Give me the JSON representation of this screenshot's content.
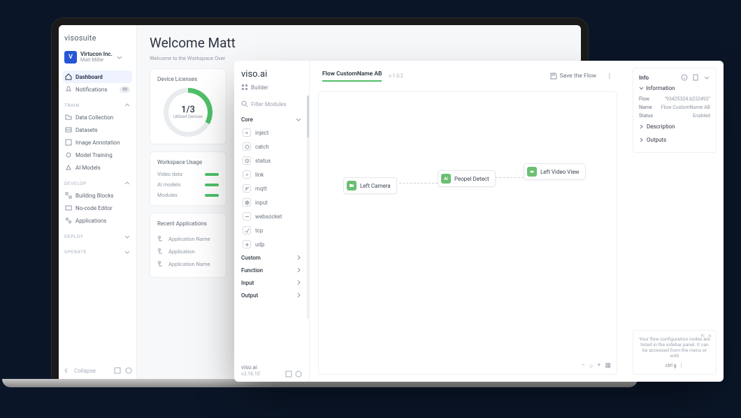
{
  "suite": {
    "brand": "visosuite",
    "org": {
      "logo_letter": "V",
      "name": "Virtucon Inc.",
      "user": "Matt Miller"
    },
    "nav_primary": [
      {
        "label": "Dashboard",
        "active": true
      },
      {
        "label": "Notifications",
        "badge": "99"
      }
    ],
    "groups": [
      {
        "title": "TRAIN",
        "items": [
          "Data Collection",
          "Datasets",
          "Image Annotation",
          "Model Training",
          "AI Models"
        ]
      },
      {
        "title": "DEVELOP",
        "items": [
          "Building Blocks",
          "No-code Editor",
          "Applications"
        ]
      },
      {
        "title": "DEPLOY",
        "items": []
      },
      {
        "title": "OPERATE",
        "items": []
      }
    ],
    "collapse_label": "Collapse",
    "main": {
      "welcome": "Welcome Matt",
      "subtext": "Welcome to the Workspace Over",
      "licenses_title": "Device Licenses",
      "gauge_value": "1/3",
      "gauge_label": "Utilized Devices",
      "usage_title": "Workspace Usage",
      "usage_rows": [
        "Video data",
        "AI models",
        "Modules"
      ],
      "recent_title": "Recent Applications",
      "recent_rows": [
        "Application Name",
        "Application",
        "Application Name"
      ]
    }
  },
  "builder": {
    "brand": "viso.ai",
    "builder_label": "Builder",
    "filter_placeholder": "Filter Modules",
    "categories": {
      "core_label": "Core",
      "core_nodes": [
        "inject",
        "catch",
        "status",
        "link",
        "mqtt",
        "input",
        "websocket",
        "tcp",
        "udp"
      ],
      "others": [
        "Custom",
        "Function",
        "Input",
        "Output"
      ]
    },
    "footer_brand": "viso.ai",
    "footer_version": "v3.16.10",
    "header": {
      "flow_name": "Flow CustomName AB",
      "flow_version": "v.1.0.2",
      "save_label": "Save the Flow"
    },
    "nodes": {
      "left_camera": "Left Camera",
      "people_detect": "Peopel Detect",
      "left_video": "Left Video View"
    },
    "info": {
      "header": "Info",
      "section_info": "Information",
      "flow_key": "Flow",
      "flow_val": "\"93425324.b232492\"",
      "name_key": "Name",
      "name_val": "Flow CustomName AB",
      "status_key": "Status",
      "status_val": "Enabled",
      "section_desc": "Description",
      "section_outputs": "Outputs",
      "hint": "Your flow configuration nodes are listed in the sidebar panel. It can be accessed from the menu or with",
      "shortcut": "ctrl g"
    }
  }
}
